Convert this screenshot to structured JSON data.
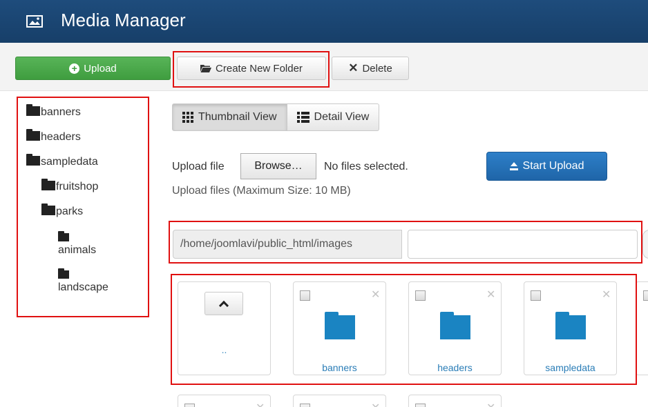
{
  "header": {
    "title": "Media Manager",
    "logo_icon": "image-icon"
  },
  "toolbar": {
    "upload_label": "Upload",
    "create_folder_label": "Create New Folder",
    "delete_label": "Delete"
  },
  "tree": {
    "items": [
      {
        "label": "banners",
        "level": 0
      },
      {
        "label": "headers",
        "level": 0
      },
      {
        "label": "sampledata",
        "level": 0
      },
      {
        "label": "fruitshop",
        "level": 1
      },
      {
        "label": "parks",
        "level": 1
      },
      {
        "label": "animals",
        "level": 2
      },
      {
        "label": "landscape",
        "level": 2
      }
    ]
  },
  "views": {
    "thumbnail_label": "Thumbnail View",
    "detail_label": "Detail View",
    "active": "thumbnail"
  },
  "upload": {
    "file_label": "Upload file",
    "browse_label": "Browse…",
    "no_files_label": "No files selected.",
    "start_label": "Start Upload",
    "max_size_label": "Upload files (Maximum Size: 10 MB)"
  },
  "path": {
    "base": "/home/joomlavi/public_html/images",
    "value": ""
  },
  "thumbs": {
    "up_label": "..",
    "folders": [
      {
        "label": "banners"
      },
      {
        "label": "headers"
      },
      {
        "label": "sampledata"
      }
    ]
  },
  "colors": {
    "header_bg": "#1e4c7c",
    "upload_green": "#4cab4c",
    "start_blue": "#2472b8",
    "folder_blue": "#1a84c2",
    "highlight_red": "#e01010"
  }
}
